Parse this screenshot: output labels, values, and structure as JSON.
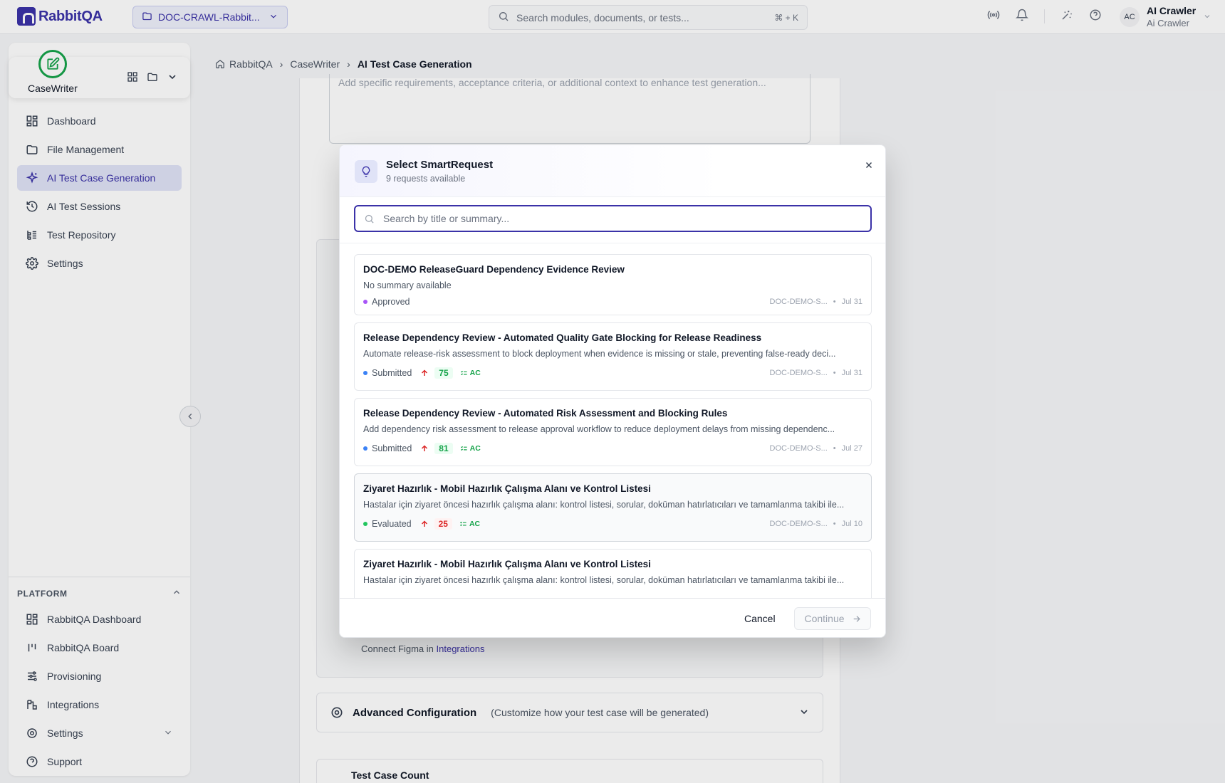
{
  "app": {
    "name": "RabbitQA"
  },
  "header": {
    "project": "DOC-CRAWL-Rabbit...",
    "search_placeholder": "Search modules, documents, or tests...",
    "search_shortcut": "⌘ + K",
    "user_initials": "AC",
    "user_name": "AI Crawler",
    "user_sub": "Ai Crawler"
  },
  "sidebar": {
    "module": "CaseWriter",
    "items": [
      {
        "label": "Dashboard",
        "icon": "dashboard-icon"
      },
      {
        "label": "File Management",
        "icon": "folder-icon"
      },
      {
        "label": "AI Test Case Generation",
        "icon": "sparkle-icon",
        "active": true
      },
      {
        "label": "AI Test Sessions",
        "icon": "history-icon"
      },
      {
        "label": "Test Repository",
        "icon": "repository-icon"
      },
      {
        "label": "Settings",
        "icon": "gear-icon"
      }
    ],
    "platform_label": "PLATFORM",
    "platform_items": [
      {
        "label": "RabbitQA Dashboard",
        "icon": "dashboard-icon"
      },
      {
        "label": "RabbitQA Board",
        "icon": "board-icon"
      },
      {
        "label": "Provisioning",
        "icon": "sliders-icon"
      },
      {
        "label": "Integrations",
        "icon": "integrations-icon"
      },
      {
        "label": "Settings",
        "icon": "gear-icon"
      },
      {
        "label": "Support",
        "icon": "help-icon"
      }
    ]
  },
  "breadcrumb": [
    "RabbitQA",
    "CaseWriter",
    "AI Test Case Generation"
  ],
  "page": {
    "textarea_placeholder": "Add specific requirements, acceptance criteria, or additional context to enhance test generation...",
    "figma_note": "Connect Figma in",
    "figma_link": "Integrations",
    "advanced_title": "Advanced Configuration",
    "advanced_sub": "(Customize how your test case will be generated)",
    "test_count_title": "Test Case Count"
  },
  "modal": {
    "title": "Select SmartRequest",
    "subtitle": "9 requests available",
    "search_placeholder": "Search by title or summary...",
    "requests": [
      {
        "title": "DOC-DEMO ReleaseGuard Dependency Evidence Review",
        "summary": "No summary available",
        "status": "Approved",
        "status_color": "#a855f7",
        "score": "",
        "ac": false,
        "code": "DOC-DEMO-S...",
        "date": "Jul 31"
      },
      {
        "title": "Release Dependency Review - Automated Quality Gate Blocking for Release Readiness",
        "summary": "Automate release-risk assessment to block deployment when evidence is missing or stale, preventing false-ready deci...",
        "status": "Submitted",
        "status_color": "#3b82f6",
        "score": "75",
        "score_level": "good",
        "ac": true,
        "ac_label": "AC",
        "code": "DOC-DEMO-S...",
        "date": "Jul 31"
      },
      {
        "title": "Release Dependency Review - Automated Risk Assessment and Blocking Rules",
        "summary": "Add dependency risk assessment to release approval workflow to reduce deployment delays from missing dependenc...",
        "status": "Submitted",
        "status_color": "#3b82f6",
        "score": "81",
        "score_level": "good",
        "ac": true,
        "ac_label": "AC",
        "code": "DOC-DEMO-S...",
        "date": "Jul 27"
      },
      {
        "title": "Ziyaret Hazırlık - Mobil Hazırlık Çalışma Alanı ve Kontrol Listesi",
        "summary": "Hastalar için ziyaret öncesi hazırlık çalışma alanı: kontrol listesi, sorular, doküman hatırlatıcıları ve tamamlanma takibi ile...",
        "status": "Evaluated",
        "status_color": "#22c55e",
        "score": "25",
        "score_level": "bad",
        "ac": true,
        "ac_label": "AC",
        "code": "DOC-DEMO-S...",
        "date": "Jul 10"
      },
      {
        "title": "Ziyaret Hazırlık - Mobil Hazırlık Çalışma Alanı ve Kontrol Listesi",
        "summary": "Hastalar için ziyaret öncesi hazırlık çalışma alanı: kontrol listesi, sorular, doküman hatırlatıcıları ve tamamlanma takibi ile...",
        "status": "",
        "status_color": "#22c55e",
        "score": "",
        "ac": false,
        "code": "",
        "date": ""
      }
    ],
    "cancel_label": "Cancel",
    "continue_label": "Continue"
  }
}
